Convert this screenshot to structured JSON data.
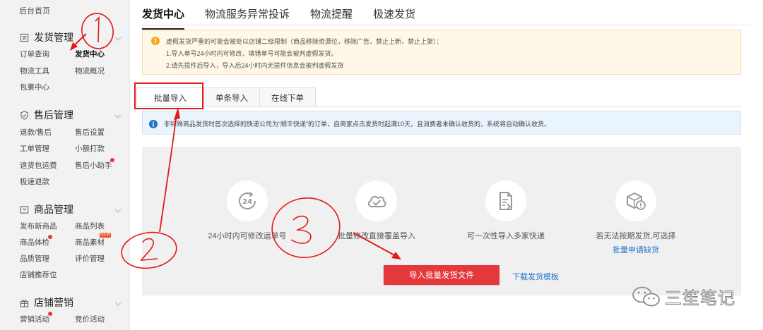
{
  "sidebar": {
    "home": "后台首页",
    "sections": [
      {
        "title": "发货管理",
        "links": [
          "订单查询",
          "发货中心",
          "物流工具",
          "物流概况",
          "包裹中心"
        ]
      },
      {
        "title": "售后管理",
        "links": [
          "退款/售后",
          "售后设置",
          "工单管理",
          "小额打款",
          "退货包运费",
          "售后小助手",
          "极速退款"
        ]
      },
      {
        "title": "商品管理",
        "links": [
          "发布新商品",
          "商品列表",
          "商品体检",
          "商品素材",
          "品质管理",
          "评价管理",
          "店铺推荐位"
        ]
      },
      {
        "title": "店铺营销",
        "links": [
          "营销活动",
          "竞价活动"
        ]
      }
    ],
    "new_badge": "NEW"
  },
  "top_tabs": [
    "发货中心",
    "物流服务异常投诉",
    "物流提醒",
    "极速发货"
  ],
  "warning": {
    "line1": "虚假发货严重的可能会被处以店铺二级限制（商品移除资源位，移除广告，禁止上新，禁止上架）：",
    "line2": "1.导入单号24小时内可修改，填错单号可能会被判虚假发货。",
    "line3": "2.请先揽件后导入，导入后24小时内无揽件信息会被判虚假发货"
  },
  "sub_tabs": [
    "批量导入",
    "单条导入",
    "在线下单"
  ],
  "info": "非特殊商品发货时首次选择的快递公司为“顺丰快递”的订单，自商家点击发货时起满10天，且消费者未确认收货的，系统将自动确认收货。",
  "features": [
    {
      "icon": "24h-clock-icon",
      "label": "24小时内可修改运单号"
    },
    {
      "icon": "cloud-check-icon",
      "label": "批量修改直接覆盖导入"
    },
    {
      "icon": "document-import-icon",
      "label": "可一次性导入多家快递"
    },
    {
      "icon": "package-alert-icon",
      "label": "若无法按期发货,可选择",
      "link": "批量申请缺货"
    }
  ],
  "import_button": "导入批量发货文件",
  "download_link": "下载发货模板",
  "watermark": "三笙笔记",
  "annotations": [
    "1",
    "2",
    "3"
  ],
  "colors": {
    "accent_red": "#e4393c",
    "link_blue": "#1e73c9",
    "warn_bg": "#fff8e6",
    "info_bg": "#eaf4fd",
    "annotation_red": "#e21a1a"
  }
}
